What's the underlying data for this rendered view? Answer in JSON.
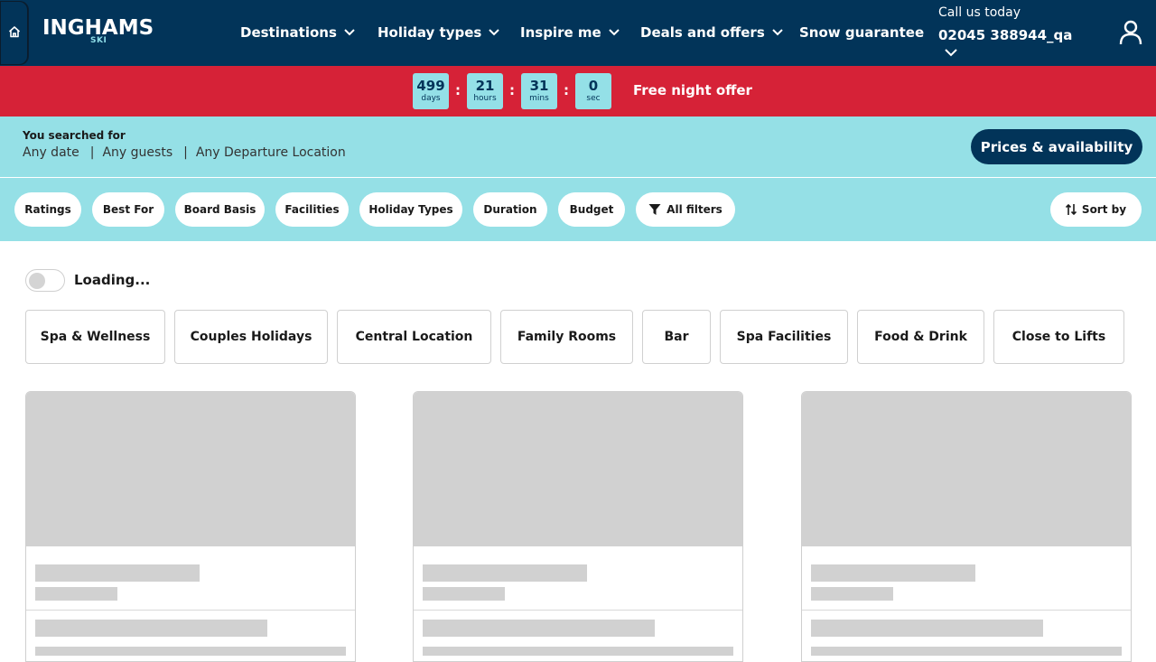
{
  "header": {
    "brand": "INGHAMS",
    "brand_sub": "SKI",
    "nav": [
      {
        "label": "Destinations",
        "icon": "chevron-down-icon"
      },
      {
        "label": "Holiday types",
        "icon": "chevron-down-icon"
      },
      {
        "label": "Inspire me",
        "icon": "chevron-down-icon"
      },
      {
        "label": "Deals and offers",
        "icon": "chevron-down-icon"
      },
      {
        "label": "Snow guarantee"
      }
    ],
    "call_label": "Call us today",
    "phone": "02045 388944_qa",
    "icons": [
      "home-icon",
      "account-icon",
      "chevron-down-icon"
    ]
  },
  "promo": {
    "countdown": [
      {
        "value": "499",
        "unit": "days"
      },
      {
        "value": "21",
        "unit": "hours"
      },
      {
        "value": "31",
        "unit": "mins"
      },
      {
        "value": "0",
        "unit": "sec"
      }
    ],
    "separator": ":",
    "offer_text": "Free night offer"
  },
  "summary": {
    "label": "You searched for",
    "date": "Any date",
    "guests": "Any guests",
    "departure": "Any Departure Location",
    "separator": "|",
    "prices_button": "Prices & availability"
  },
  "filters": {
    "chips": [
      "Ratings",
      "Best For",
      "Board Basis",
      "Facilities",
      "Holiday Types",
      "Duration",
      "Budget"
    ],
    "all_filters": "All filters",
    "sort_by": "Sort by"
  },
  "status": {
    "loading_text": "Loading..."
  },
  "tags": [
    "Spa & Wellness",
    "Couples Holidays",
    "Central Location",
    "Family Rooms",
    "Bar",
    "Spa Facilities",
    "Food & Drink",
    "Close to Lifts"
  ],
  "colors": {
    "navy": "#023459",
    "promo_red": "#d62237",
    "aqua": "#95e0e6",
    "skeleton": "#d1d1d1"
  }
}
